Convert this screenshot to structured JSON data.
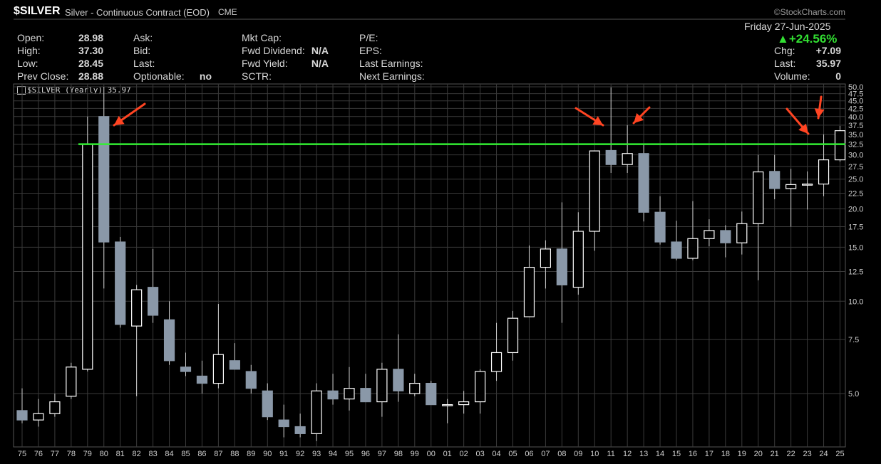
{
  "header": {
    "symbol": "$SILVER",
    "description": "Silver - Continuous Contract (EOD)",
    "exchange": "CME",
    "watermark": "©StockCharts.com",
    "date": "Friday 27-Jun-2025",
    "change_pct": "▲+24.56%"
  },
  "quote": {
    "col1": [
      {
        "label": "Open:",
        "value": "28.98"
      },
      {
        "label": "High:",
        "value": "37.30"
      },
      {
        "label": "Low:",
        "value": "28.45"
      },
      {
        "label": "Prev Close:",
        "value": "28.88"
      }
    ],
    "col2": [
      {
        "label": "Ask:",
        "value": ""
      },
      {
        "label": "Bid:",
        "value": ""
      },
      {
        "label": "Last:",
        "value": ""
      },
      {
        "label": "Optionable:",
        "value": "no"
      }
    ],
    "col3": [
      {
        "label": "Mkt Cap:",
        "value": ""
      },
      {
        "label": "Fwd Dividend:",
        "value": "N/A"
      },
      {
        "label": "Fwd Yield:",
        "value": "N/A"
      },
      {
        "label": "SCTR:",
        "value": ""
      }
    ],
    "col4": [
      {
        "label": "P/E:",
        "value": ""
      },
      {
        "label": "EPS:",
        "value": ""
      },
      {
        "label": "Last Earnings:",
        "value": ""
      },
      {
        "label": "Next Earnings:",
        "value": ""
      }
    ],
    "right": [
      {
        "label": "Chg:",
        "value": "+7.09"
      },
      {
        "label": "Last:",
        "value": "35.97"
      },
      {
        "label": "Volume:",
        "value": "0"
      }
    ]
  },
  "colors": {
    "background": "#000000",
    "grid": "#3a3a3a",
    "up_candle": "#ffffff",
    "down_candle": "#8a98a8",
    "wick": "#d0d0d0",
    "horizontal_line": "#33ee33",
    "arrows": "#ff4422",
    "change_text": "#32e032"
  },
  "chart_data": {
    "type": "candlestick",
    "legend": "$SILVER (Yearly) 35.97",
    "scale": "log",
    "y_ticks": [
      "5.0",
      "7.5",
      "10.0",
      "12.5",
      "15.0",
      "17.5",
      "20.0",
      "22.5",
      "25.0",
      "27.5",
      "30.0",
      "32.5",
      "35.0",
      "37.5",
      "40.0",
      "42.5",
      "45.0",
      "47.5",
      "50.0"
    ],
    "x_ticks": [
      "75",
      "76",
      "77",
      "78",
      "79",
      "80",
      "81",
      "82",
      "83",
      "84",
      "85",
      "86",
      "87",
      "88",
      "89",
      "90",
      "91",
      "92",
      "93",
      "94",
      "95",
      "96",
      "97",
      "98",
      "99",
      "00",
      "01",
      "02",
      "03",
      "04",
      "05",
      "06",
      "07",
      "08",
      "09",
      "10",
      "11",
      "12",
      "13",
      "14",
      "15",
      "16",
      "17",
      "18",
      "19",
      "20",
      "21",
      "22",
      "23",
      "24",
      "25"
    ],
    "horizontal_line": 32.5,
    "arrows_at": [
      "80",
      "11",
      "12",
      "24",
      "24b"
    ],
    "candles": [
      {
        "x": "75",
        "o": 4.4,
        "h": 5.2,
        "l": 4.0,
        "c": 4.1
      },
      {
        "x": "76",
        "o": 4.1,
        "h": 4.8,
        "l": 3.9,
        "c": 4.3
      },
      {
        "x": "77",
        "o": 4.3,
        "h": 5.0,
        "l": 4.2,
        "c": 4.7
      },
      {
        "x": "78",
        "o": 4.9,
        "h": 6.3,
        "l": 4.8,
        "c": 6.1
      },
      {
        "x": "79",
        "o": 6.0,
        "h": 40.0,
        "l": 5.9,
        "c": 32.5
      },
      {
        "x": "80",
        "o": 40.0,
        "h": 50.0,
        "l": 11.0,
        "c": 15.6
      },
      {
        "x": "81",
        "o": 15.6,
        "h": 16.2,
        "l": 8.2,
        "c": 8.4
      },
      {
        "x": "82",
        "o": 8.3,
        "h": 11.3,
        "l": 4.9,
        "c": 10.9
      },
      {
        "x": "83",
        "o": 11.1,
        "h": 14.8,
        "l": 8.5,
        "c": 9.0
      },
      {
        "x": "84",
        "o": 8.7,
        "h": 10.0,
        "l": 6.2,
        "c": 6.4
      },
      {
        "x": "85",
        "o": 6.1,
        "h": 6.8,
        "l": 5.7,
        "c": 5.9
      },
      {
        "x": "86",
        "o": 5.7,
        "h": 6.4,
        "l": 5.0,
        "c": 5.4
      },
      {
        "x": "87",
        "o": 5.4,
        "h": 9.8,
        "l": 5.2,
        "c": 6.7
      },
      {
        "x": "88",
        "o": 6.4,
        "h": 7.3,
        "l": 6.0,
        "c": 6.0
      },
      {
        "x": "89",
        "o": 5.9,
        "h": 6.2,
        "l": 5.0,
        "c": 5.2
      },
      {
        "x": "90",
        "o": 5.1,
        "h": 5.4,
        "l": 4.1,
        "c": 4.2
      },
      {
        "x": "91",
        "o": 4.1,
        "h": 4.6,
        "l": 3.6,
        "c": 3.9
      },
      {
        "x": "92",
        "o": 3.9,
        "h": 4.3,
        "l": 3.6,
        "c": 3.7
      },
      {
        "x": "93",
        "o": 3.7,
        "h": 5.4,
        "l": 3.5,
        "c": 5.1
      },
      {
        "x": "94",
        "o": 5.1,
        "h": 5.8,
        "l": 4.6,
        "c": 4.8
      },
      {
        "x": "95",
        "o": 4.8,
        "h": 6.1,
        "l": 4.4,
        "c": 5.2
      },
      {
        "x": "96",
        "o": 5.2,
        "h": 5.8,
        "l": 4.7,
        "c": 4.7
      },
      {
        "x": "97",
        "o": 4.7,
        "h": 6.3,
        "l": 4.2,
        "c": 6.0
      },
      {
        "x": "98",
        "o": 6.0,
        "h": 7.8,
        "l": 4.7,
        "c": 5.1
      },
      {
        "x": "99",
        "o": 5.0,
        "h": 5.8,
        "l": 4.9,
        "c": 5.4
      },
      {
        "x": "00",
        "o": 5.4,
        "h": 5.5,
        "l": 4.6,
        "c": 4.6
      },
      {
        "x": "01",
        "o": 4.6,
        "h": 4.8,
        "l": 4.0,
        "c": 4.6
      },
      {
        "x": "02",
        "o": 4.6,
        "h": 5.1,
        "l": 4.3,
        "c": 4.7
      },
      {
        "x": "03",
        "o": 4.7,
        "h": 6.0,
        "l": 4.3,
        "c": 5.9
      },
      {
        "x": "04",
        "o": 5.9,
        "h": 8.5,
        "l": 5.5,
        "c": 6.8
      },
      {
        "x": "05",
        "o": 6.8,
        "h": 9.3,
        "l": 6.4,
        "c": 8.8
      },
      {
        "x": "06",
        "o": 8.9,
        "h": 15.2,
        "l": 8.9,
        "c": 12.9
      },
      {
        "x": "07",
        "o": 12.9,
        "h": 15.8,
        "l": 11.0,
        "c": 14.8
      },
      {
        "x": "08",
        "o": 14.8,
        "h": 21.0,
        "l": 8.5,
        "c": 11.3
      },
      {
        "x": "09",
        "o": 11.1,
        "h": 19.5,
        "l": 10.5,
        "c": 16.9
      },
      {
        "x": "10",
        "o": 16.9,
        "h": 31.0,
        "l": 14.6,
        "c": 30.9
      },
      {
        "x": "11",
        "o": 31.0,
        "h": 49.8,
        "l": 26.2,
        "c": 27.9
      },
      {
        "x": "12",
        "o": 27.9,
        "h": 37.5,
        "l": 26.2,
        "c": 30.3
      },
      {
        "x": "13",
        "o": 30.3,
        "h": 32.5,
        "l": 18.2,
        "c": 19.5
      },
      {
        "x": "14",
        "o": 19.5,
        "h": 22.0,
        "l": 15.3,
        "c": 15.6
      },
      {
        "x": "15",
        "o": 15.6,
        "h": 18.3,
        "l": 13.6,
        "c": 13.8
      },
      {
        "x": "16",
        "o": 13.8,
        "h": 21.2,
        "l": 13.6,
        "c": 16.0
      },
      {
        "x": "17",
        "o": 16.0,
        "h": 18.5,
        "l": 15.1,
        "c": 17.0
      },
      {
        "x": "18",
        "o": 17.0,
        "h": 17.7,
        "l": 13.9,
        "c": 15.5
      },
      {
        "x": "19",
        "o": 15.5,
        "h": 19.6,
        "l": 14.2,
        "c": 17.9
      },
      {
        "x": "20",
        "o": 17.9,
        "h": 30.0,
        "l": 11.7,
        "c": 26.4
      },
      {
        "x": "21",
        "o": 26.5,
        "h": 30.0,
        "l": 21.5,
        "c": 23.3
      },
      {
        "x": "22",
        "o": 23.3,
        "h": 27.0,
        "l": 17.5,
        "c": 24.0
      },
      {
        "x": "23",
        "o": 23.9,
        "h": 26.5,
        "l": 19.9,
        "c": 24.1
      },
      {
        "x": "24",
        "o": 24.1,
        "h": 35.0,
        "l": 22.0,
        "c": 28.9
      },
      {
        "x": "25",
        "o": 28.9,
        "h": 37.3,
        "l": 28.5,
        "c": 35.97
      }
    ]
  }
}
